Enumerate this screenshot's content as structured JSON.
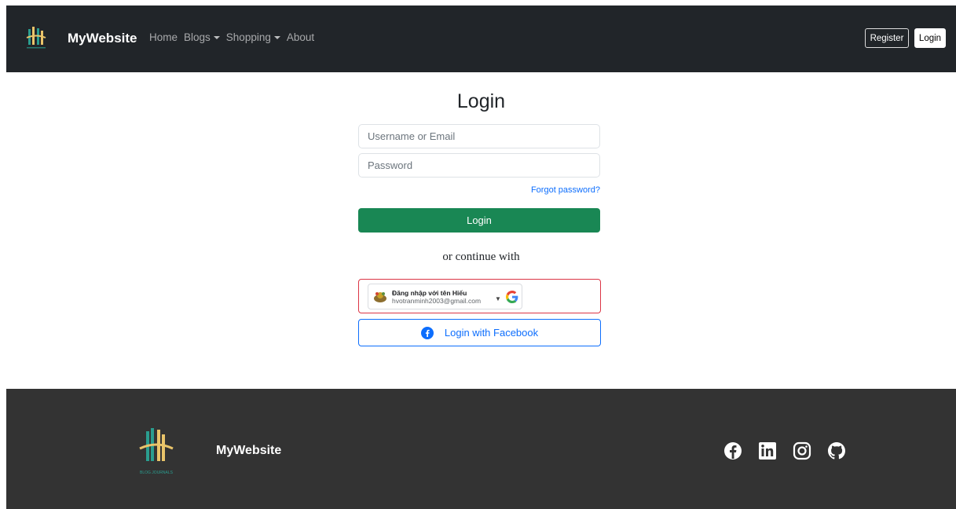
{
  "navbar": {
    "brand": "MyWebsite",
    "links": [
      {
        "label": "Home",
        "dropdown": false
      },
      {
        "label": "Blogs",
        "dropdown": true
      },
      {
        "label": "Shopping",
        "dropdown": true
      },
      {
        "label": "About",
        "dropdown": false
      }
    ],
    "register_label": "Register",
    "login_label": "Login"
  },
  "login_form": {
    "title": "Login",
    "username_placeholder": "Username or Email",
    "password_placeholder": "Password",
    "forgot_label": "Forgot password?",
    "submit_label": "Login",
    "continue_label": "or continue with",
    "google": {
      "name": "Đăng nhập với tên Hiếu",
      "email": "hvotranminh2003@gmail.com"
    },
    "facebook_label": "Login with Facebook"
  },
  "footer": {
    "brand": "MyWebsite",
    "logo_text": "BLOG JOURNALS",
    "social_icons": [
      "facebook-icon",
      "linkedin-icon",
      "instagram-icon",
      "github-icon"
    ]
  },
  "colors": {
    "navbar_bg": "#212529",
    "footer_bg": "#333333",
    "login_button": "#198754",
    "link": "#0d6efd",
    "google_border": "#dc3545"
  }
}
